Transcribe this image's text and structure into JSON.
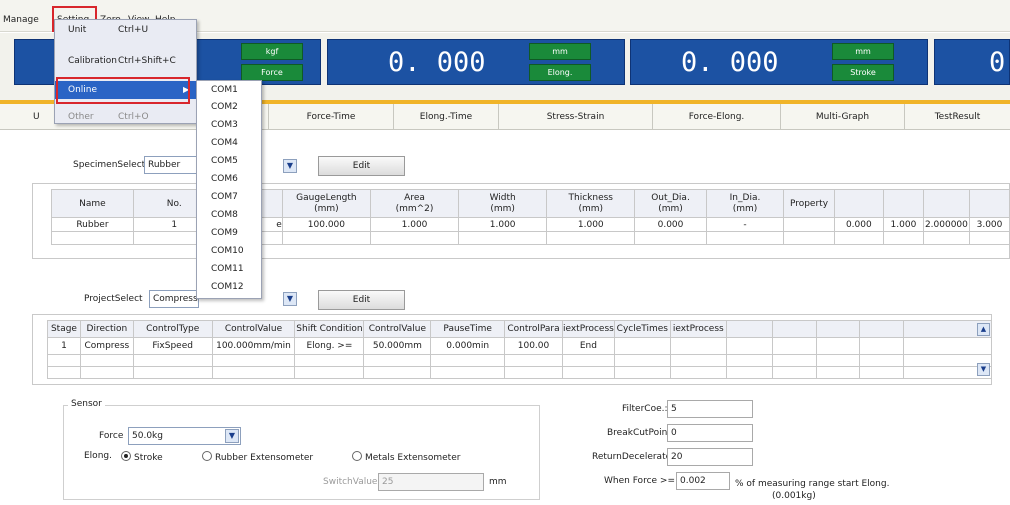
{
  "menubar": {
    "items": [
      "Manage",
      "Setting",
      "Zero",
      "View",
      "Help"
    ]
  },
  "displays": [
    {
      "value": "",
      "unit": "kgf",
      "label": "Force"
    },
    {
      "value": "0. 000",
      "unit": "mm",
      "label": "Elong."
    },
    {
      "value": "0. 000",
      "unit": "mm",
      "label": "Stroke"
    },
    {
      "value": "0"
    }
  ],
  "tabs": [
    "U",
    "Force-Time",
    "Elong.-Time",
    "Stress-Strain",
    "Force-Elong.",
    "Multi-Graph",
    "TestResult"
  ],
  "setting_menu": {
    "items": [
      {
        "label": "Unit",
        "shortcut": "Ctrl+U"
      },
      {
        "label": "Calibration",
        "shortcut": "Ctrl+Shift+C"
      },
      {
        "label": "Online",
        "shortcut": "",
        "arrow": "▶"
      },
      {
        "label": "Other",
        "shortcut": "Ctrl+O"
      }
    ]
  },
  "com_menu": [
    "COM1",
    "COM2",
    "COM3",
    "COM4",
    "COM5",
    "COM6",
    "COM7",
    "COM8",
    "COM9",
    "COM10",
    "COM11",
    "COM12"
  ],
  "specimen": {
    "select_label": "SpecimenSelect",
    "select_value": "Rubber",
    "edit_label": "Edit",
    "headers": [
      "Name",
      "No.",
      "",
      "GaugeLength\n(mm)",
      "Area\n(mm^2)",
      "Width\n(mm)",
      "Thickness\n(mm)",
      "Out_Dia.\n(mm)",
      "In_Dia.\n(mm)",
      "Property",
      "",
      "",
      "",
      ""
    ],
    "row": [
      "Rubber",
      "1",
      "e",
      "100.000",
      "1.000",
      "1.000",
      "1.000",
      "0.000",
      "-",
      "",
      "0.000",
      "1.000",
      "2.000000",
      "3.000"
    ]
  },
  "project": {
    "select_label": "ProjectSelect",
    "select_value": "Compressio",
    "edit_label": "Edit",
    "headers": [
      "Stage",
      "Direction",
      "ControlType",
      "ControlValue",
      "Shift Condition",
      "ControlValue",
      "PauseTime",
      "ControlPara",
      "iextProcess",
      "CycleTimes",
      "iextProcess",
      "",
      "",
      "",
      "",
      ""
    ],
    "row": [
      "1",
      "Compress",
      "FixSpeed",
      "100.000mm/min",
      "Elong. >=",
      "50.000mm",
      "0.000min",
      "100.00",
      "End",
      "",
      "",
      "",
      "",
      "",
      "",
      ""
    ]
  },
  "sensor": {
    "group_label": "Sensor",
    "force_label": "Force",
    "force_value": "50.0kg",
    "elong_label": "Elong.",
    "radio_stroke": "Stroke",
    "radio_rubber": "Rubber Extensometer",
    "radio_metals": "Metals Extensometer",
    "switch_label": "SwitchValue:",
    "switch_value": "25",
    "switch_unit": "mm"
  },
  "params": {
    "filter_label": "FilterCoe.:",
    "filter_value": "5",
    "break_label": "BreakCutPoint:",
    "break_value": "0",
    "return_label": "ReturnDecelerateC",
    "return_value": "20",
    "when_label": "When Force >=",
    "when_value": "0.002",
    "when_note": "% of measuring range start Elong.",
    "when_note2": "(0.001kg)"
  }
}
